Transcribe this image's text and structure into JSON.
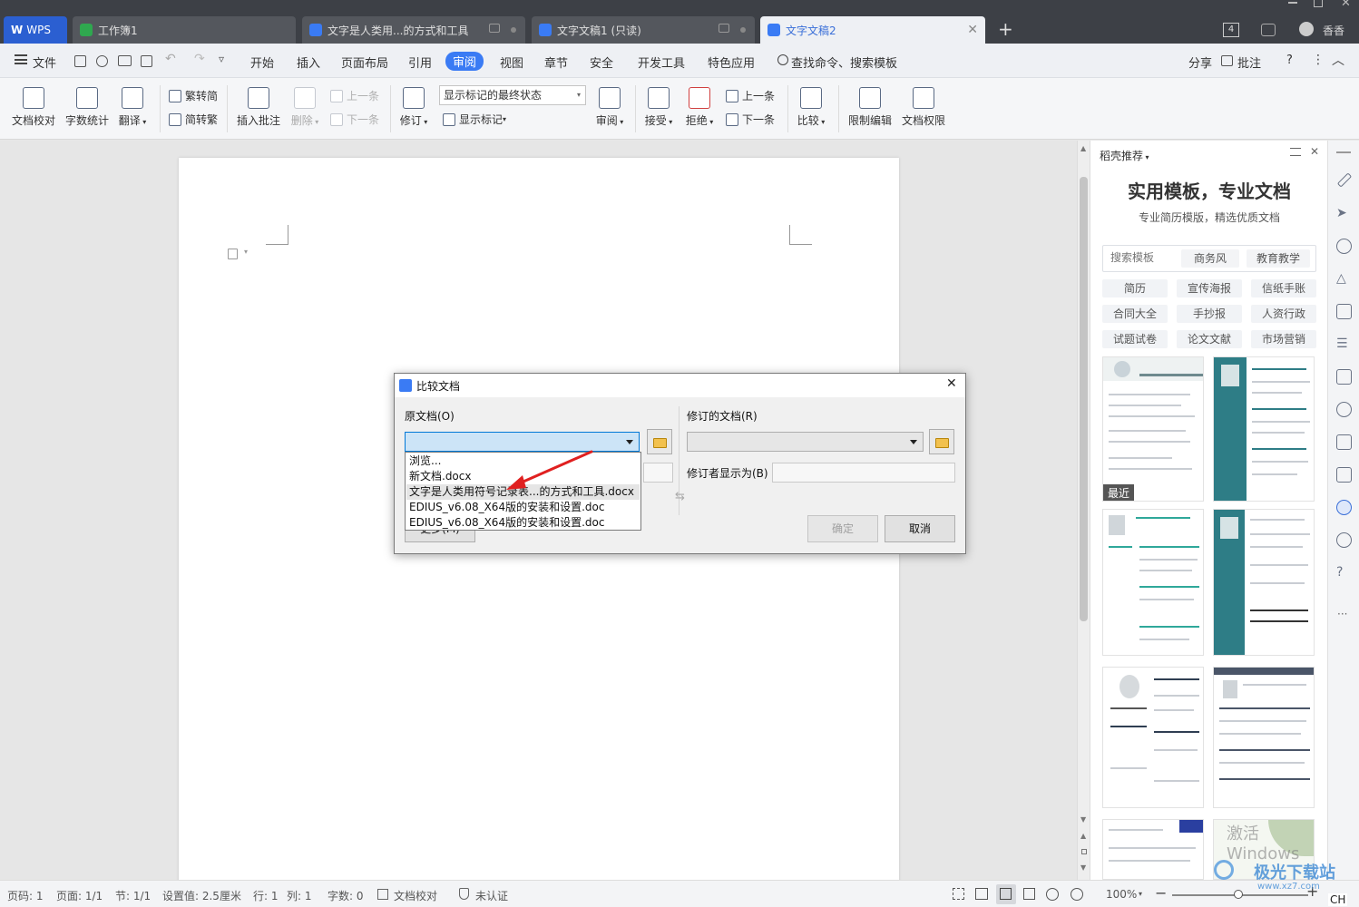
{
  "tabs": {
    "wps": "WPS",
    "t1": "工作簿1",
    "t2": "文字是人类用...的方式和工具",
    "t3": "文字文稿1 (只读)",
    "t4": "文字文稿2",
    "add": "+",
    "count": "4",
    "user": "香香"
  },
  "menu": {
    "file": "文件",
    "items": [
      "开始",
      "插入",
      "页面布局",
      "引用",
      "审阅",
      "视图",
      "章节",
      "安全",
      "开发工具",
      "特色应用"
    ],
    "search": "查找命令、搜索模板",
    "share": "分享",
    "comment": "批注",
    "help": "?"
  },
  "ribbon": {
    "proofread": "文档校对",
    "wordcount": "字数统计",
    "translate": "翻译",
    "t2s": "繁转简",
    "s2t": "简转繁",
    "insert_comment": "插入批注",
    "delete": "删除",
    "prev_c": "上一条",
    "next_c": "下一条",
    "revise": "修订",
    "display_select": "显示标记的最终状态",
    "show_marks": "显示标记",
    "review": "审阅",
    "accept": "接受",
    "reject": "拒绝",
    "prev": "上一条",
    "next": "下一条",
    "compare": "比较",
    "restrict": "限制编辑",
    "permission": "文档权限"
  },
  "panel": {
    "header": "稻壳推荐",
    "title": "实用模板，专业文档",
    "subtitle": "专业简历模版，精选优质文档",
    "search_placeholder": "搜索模板",
    "search_tags": [
      "商务风",
      "教育教学"
    ],
    "chips": [
      "简历",
      "宣传海报",
      "信纸手账",
      "合同大全",
      "手抄报",
      "人资行政",
      "试题试卷",
      "论文文献",
      "市场营销"
    ],
    "recent": "最近"
  },
  "dialog": {
    "title": "比较文档",
    "original_label": "原文档(O)",
    "revised_label": "修订的文档(R)",
    "reviewer_label": "修订者显示为(B)",
    "ok": "确定",
    "cancel": "取消",
    "more": "更多(M)",
    "options": [
      "浏览...",
      "新文档.docx",
      "文字是人类用符号记录表...的方式和工具.docx",
      "EDIUS_v6.08_X64版的安装和设置.doc",
      "EDIUS_v6.08_X64版的安装和设置.doc"
    ],
    "highlighted_index": 2
  },
  "status": {
    "page": "页码: 1",
    "pages": "页面: 1/1",
    "section": "节: 1/1",
    "setting": "设置值: 2.5厘米",
    "row": "行: 1",
    "col": "列: 1",
    "words": "字数: 0",
    "proof": "文档校对",
    "cert": "未认证",
    "zoom": "100%",
    "ime": "CH"
  },
  "watermark": {
    "line1": "激活 Windows",
    "site": "极光下载站",
    "url": "www.xz7.com"
  },
  "colors": {
    "accent": "#3a7bf4",
    "titlebar": "#3d4046",
    "arrow": "#e02020",
    "template_teal": "#2e7d86"
  }
}
